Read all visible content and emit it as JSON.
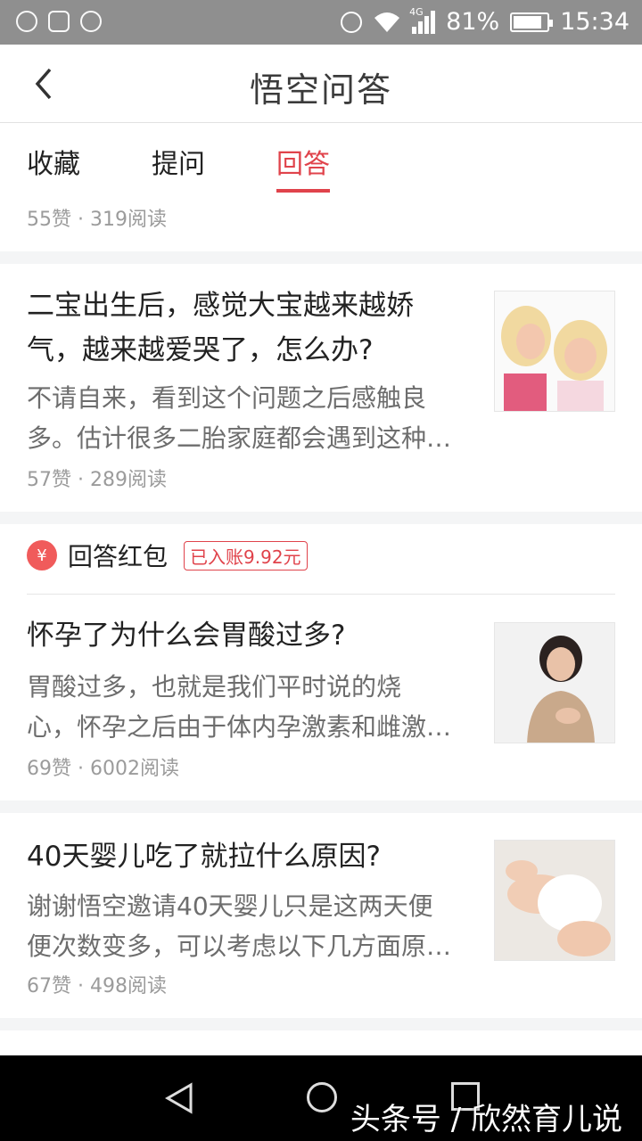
{
  "status_bar": {
    "battery_percent": "81%",
    "time": "15:34",
    "network": "4G",
    "icons": [
      "location-icon",
      "image-icon",
      "settings-icon",
      "alarm-icon",
      "wifi-icon",
      "signal-icon",
      "battery-icon"
    ]
  },
  "header": {
    "title": "悟空问答",
    "back_icon": "chevron-left-icon"
  },
  "tabs": [
    {
      "label": "收藏",
      "active": false
    },
    {
      "label": "提问",
      "active": false
    },
    {
      "label": "回答",
      "active": true
    }
  ],
  "accent_color": "#e0434b",
  "top_meta": "55赞 · 319阅读",
  "answers": [
    {
      "title_line1": "二宝出生后，感觉大宝越来越娇",
      "title_line2": "气，越来越爱哭了，怎么办?",
      "snippet_line1": "不请自来，看到这个问题之后感触良",
      "snippet_line2": "多。估计很多二胎家庭都会遇到这种…",
      "meta": "57赞 · 289阅读",
      "thumbnail": "two-crying-girls-image"
    },
    {
      "red_packet_label": "回答红包",
      "red_packet_badge": "已入账9.92元",
      "title_line1": "怀孕了为什么会胃酸过多?",
      "snippet_line1": "胃酸过多，也就是我们平时说的烧",
      "snippet_line2": "心，怀孕之后由于体内孕激素和雌激…",
      "meta": "69赞 · 6002阅读",
      "thumbnail": "pregnant-woman-image"
    },
    {
      "title_line1": "40天婴儿吃了就拉什么原因?",
      "snippet_line1": "谢谢悟空邀请40天婴儿只是这两天便",
      "snippet_line2": "便次数变多，可以考虑以下几方面原…",
      "meta": "67赞 · 498阅读",
      "thumbnail": "baby-diaper-image"
    }
  ],
  "nav": {
    "icons": [
      "back-triangle-icon",
      "home-circle-icon",
      "recent-square-icon"
    ]
  },
  "watermark": "头条号 / 欣然育儿说"
}
